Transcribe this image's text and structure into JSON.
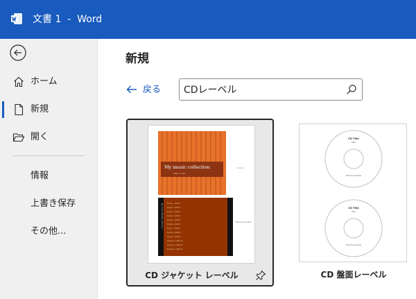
{
  "window": {
    "title": "文書 1  -  Word",
    "logo_icon": "word-logo-icon",
    "accent": "#185abd"
  },
  "sidebar": {
    "back_icon": "back-arrow-icon",
    "items": [
      {
        "label": "ホーム",
        "icon": "home-icon"
      },
      {
        "label": "新規",
        "icon": "new-document-icon",
        "active": true
      },
      {
        "label": "開く",
        "icon": "folder-open-icon"
      }
    ],
    "text_items": [
      {
        "label": "情報"
      },
      {
        "label": "上書き保存"
      },
      {
        "label": "その他..."
      }
    ]
  },
  "main": {
    "title": "新規",
    "back_label": "戻る",
    "search": {
      "value": "CDレーベル"
    },
    "templates": [
      {
        "label": "CD ジャケット レーベル",
        "selected": true,
        "pin_icon": "pin-icon",
        "preview": {
          "heading": "My music collection",
          "subheading": "Title of disc",
          "side_note": "Cover",
          "back_note": "Back and sides",
          "spine_text": "My music collection | Volume 1",
          "tracks": [
            "Song 1 - Artist 1",
            "Song 2 - Artist 2",
            "Song 3 - Artist 3",
            "Song 4 - Artist 4",
            "Song 5 - Artist 5",
            "Song 6 - Artist 6",
            "Song 7 - Artist 7",
            "Song 8 - Artist 8",
            "Song 9 - Artist 9",
            "Song 10 - Artist 10",
            "Song 11 - Artist 11",
            "Song 12 - Artist 12"
          ]
        }
      },
      {
        "label": "CD 盤面レーベル",
        "selected": false,
        "preview": {
          "disc_title": "CD Title",
          "disc_date": "Date",
          "disc_contents": "Title CD Contents"
        }
      }
    ]
  }
}
